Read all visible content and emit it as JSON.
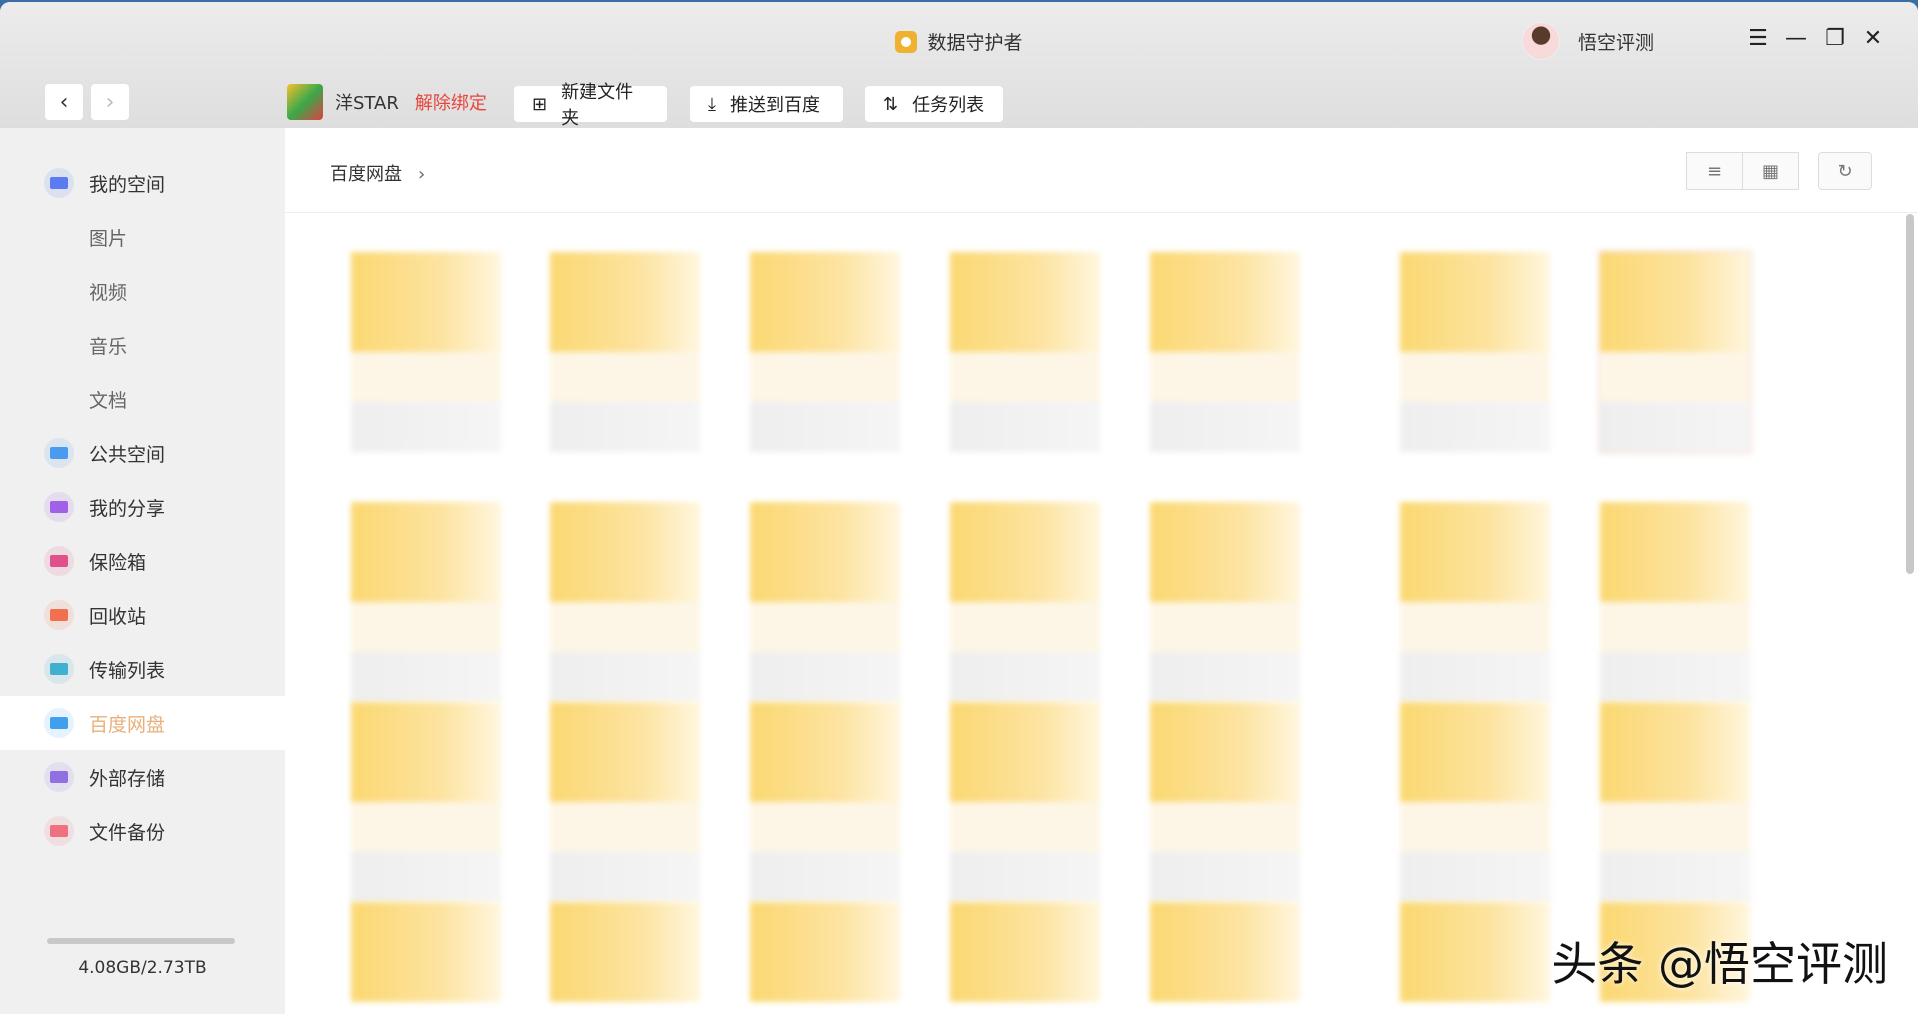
{
  "app": {
    "title": "数据守护者",
    "user": "悟空评测"
  },
  "window_controls": [
    "☰",
    "—",
    "❐",
    "✕"
  ],
  "nav": {
    "back": "‹",
    "forward": "›"
  },
  "toolbar": {
    "account": "洋STAR",
    "unbind": "解除绑定",
    "new_folder": "新建文件夹",
    "push_baidu": "推送到百度",
    "task_list": "任务列表"
  },
  "sidebar": {
    "items": [
      {
        "label": "我的空间",
        "icon": "my-space-icon",
        "color": "#5a7cf0",
        "sub": false
      },
      {
        "label": "图片",
        "sub": true
      },
      {
        "label": "视频",
        "sub": true
      },
      {
        "label": "音乐",
        "sub": true
      },
      {
        "label": "文档",
        "sub": true
      },
      {
        "label": "公共空间",
        "icon": "paper-plane-icon",
        "color": "#4a9af0",
        "sub": false
      },
      {
        "label": "我的分享",
        "icon": "share-icon",
        "color": "#a060e8",
        "sub": false
      },
      {
        "label": "保险箱",
        "icon": "safe-box-icon",
        "color": "#e0508a",
        "sub": false
      },
      {
        "label": "回收站",
        "icon": "trash-icon",
        "color": "#f07050",
        "sub": false
      },
      {
        "label": "传输列表",
        "icon": "transfer-icon",
        "color": "#40b0d0",
        "sub": false
      },
      {
        "label": "百度网盘",
        "icon": "baidu-cloud-icon",
        "color": "#40a0f0",
        "sub": false,
        "active": true
      },
      {
        "label": "外部存储",
        "icon": "external-storage-icon",
        "color": "#9070e0",
        "sub": false
      },
      {
        "label": "文件备份",
        "icon": "backup-cloud-icon",
        "color": "#f07080",
        "sub": false
      }
    ],
    "storage": "4.08GB/2.73TB"
  },
  "main": {
    "breadcrumb": "百度网盘",
    "chevron": "›",
    "view_list": "≡",
    "view_grid": "▦",
    "refresh": "↻"
  },
  "watermark": "头条 @悟空评测"
}
